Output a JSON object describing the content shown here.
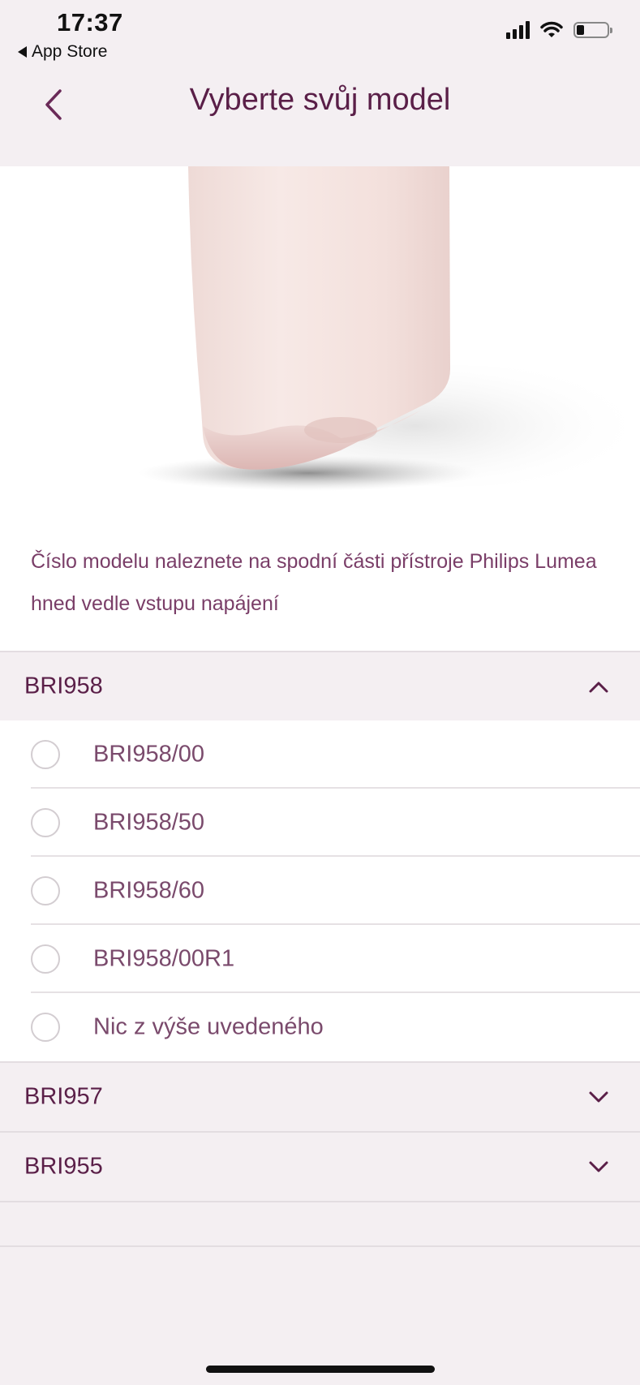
{
  "status_bar": {
    "time": "17:37",
    "back_app_label": "App Store",
    "icons": [
      "cellular-signal-icon",
      "wifi-icon",
      "battery-icon"
    ]
  },
  "nav": {
    "title": "Vyberte svůj model",
    "back_icon": "chevron-left-icon"
  },
  "description": "Číslo modelu naleznete na spodní části přístroje Philips Lumea hned vedle vstupu napájení",
  "colors": {
    "accent": "#5a1f48",
    "text_secondary": "#7a4a6c",
    "background": "#f4eff2"
  },
  "groups": [
    {
      "label": "BRI958",
      "expanded": true,
      "chevron_icon": "chevron-up-icon",
      "options": [
        {
          "label": "BRI958/00",
          "selected": false
        },
        {
          "label": "BRI958/50",
          "selected": false
        },
        {
          "label": "BRI958/60",
          "selected": false
        },
        {
          "label": "BRI958/00R1",
          "selected": false
        },
        {
          "label": "Nic z výše uvedeného",
          "selected": false
        }
      ]
    },
    {
      "label": "BRI957",
      "expanded": false,
      "chevron_icon": "chevron-down-icon"
    },
    {
      "label": "BRI955",
      "expanded": false,
      "chevron_icon": "chevron-down-icon"
    }
  ]
}
